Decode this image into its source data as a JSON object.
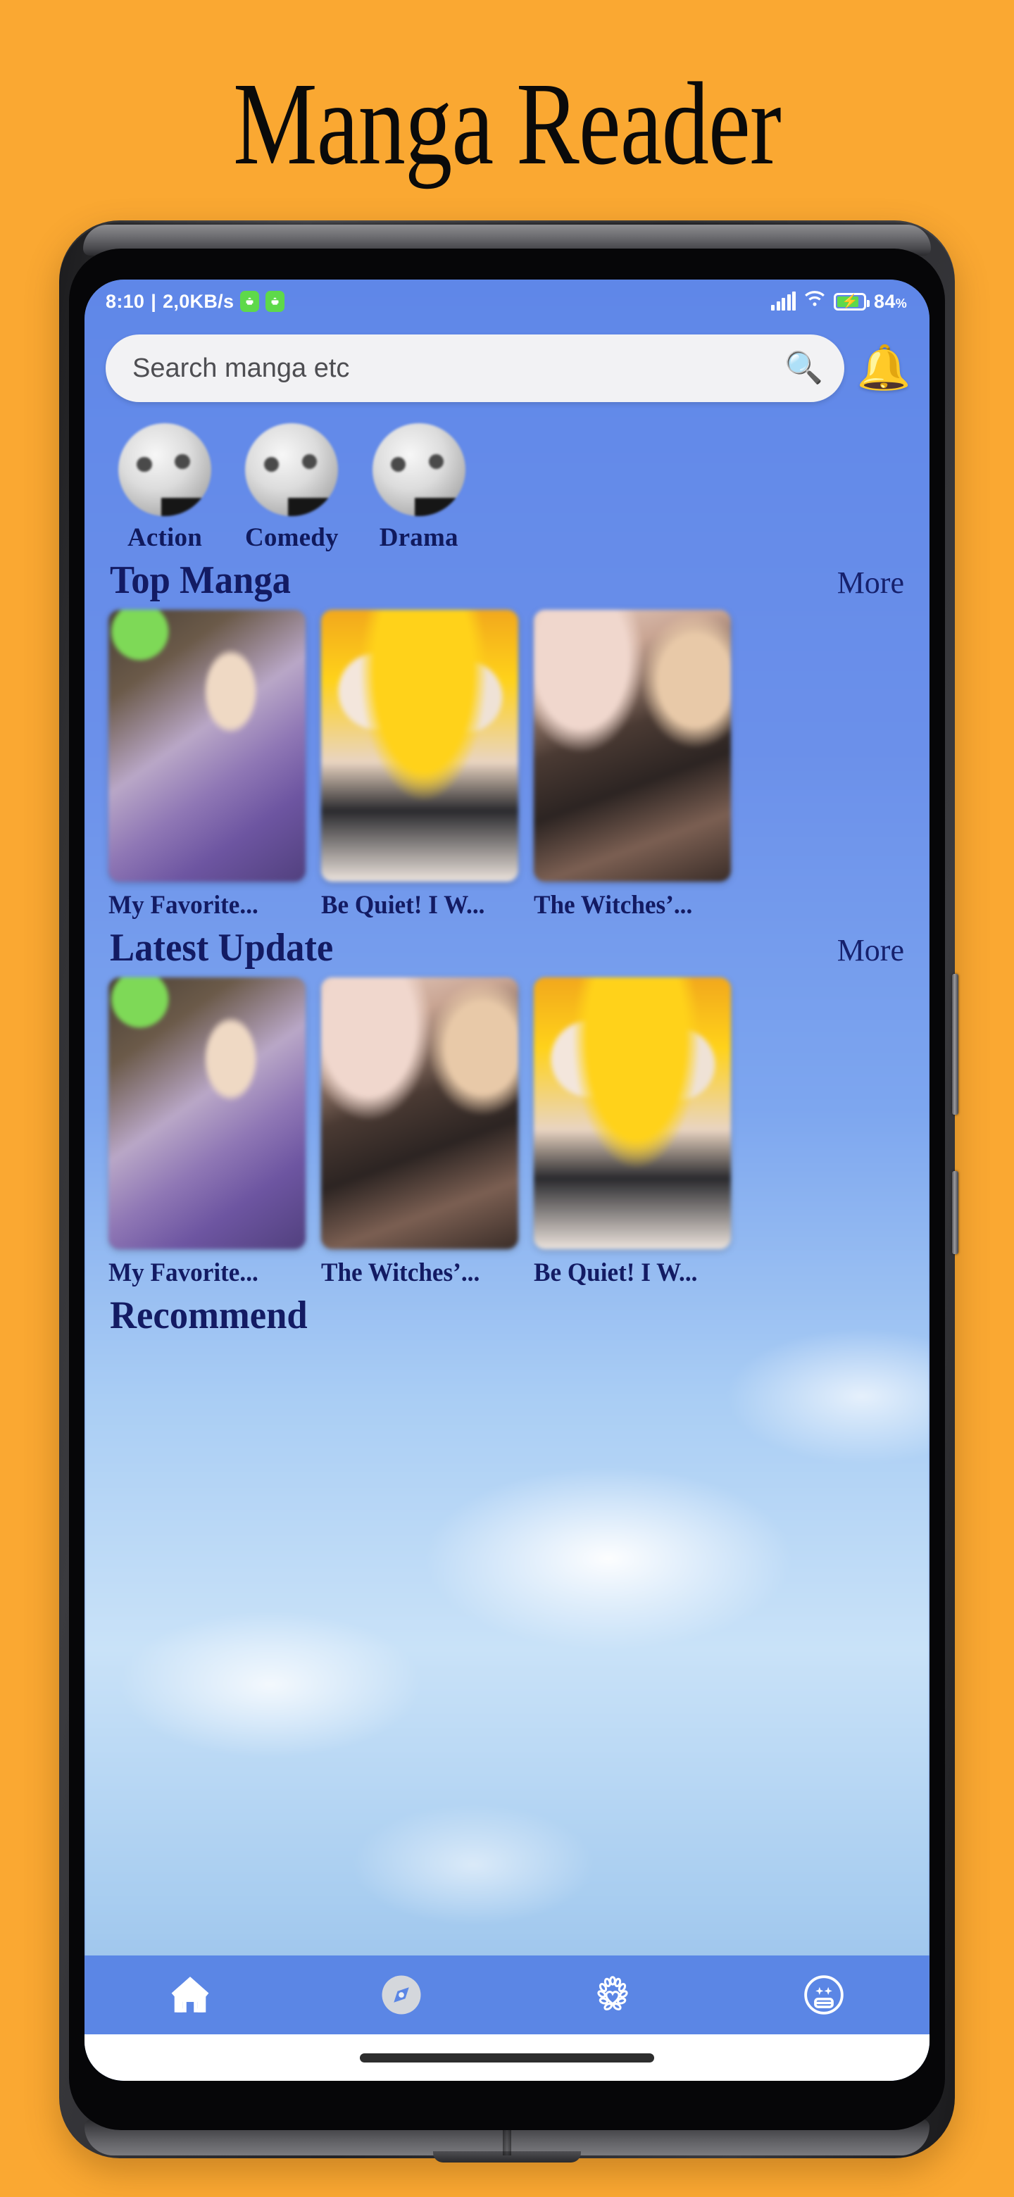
{
  "page": {
    "hero_title": "Manga Reader",
    "background_color": "#faa832",
    "app_accent_color": "#5b86e5",
    "heading_color": "#131b63"
  },
  "status_bar": {
    "time": "8:10",
    "separator": "|",
    "network_speed": "2,0KB/s",
    "app_badge_1": "android-icon",
    "app_badge_2": "android-icon",
    "signal_icon": "cellular-signal-icon",
    "wifi_icon": "wifi-icon",
    "battery_icon": "battery-charging-icon",
    "battery_percent": "84",
    "battery_percent_symbol": "%"
  },
  "search": {
    "placeholder": "Search manga etc",
    "search_icon": "magnifying-glass-icon",
    "notification_icon": "bell-icon"
  },
  "categories": [
    {
      "label": "Action",
      "avatar": "category-avatar-image"
    },
    {
      "label": "Comedy",
      "avatar": "category-avatar-image"
    },
    {
      "label": "Drama",
      "avatar": "category-avatar-image"
    }
  ],
  "sections": [
    {
      "title": "Top Manga",
      "more_label": "More",
      "items": [
        {
          "title": "My Favorite...",
          "cover": "cover-purple"
        },
        {
          "title": "Be Quiet! I W...",
          "cover": "cover-yellow"
        },
        {
          "title": "The Witches’...",
          "cover": "cover-dark"
        }
      ]
    },
    {
      "title": "Latest Update",
      "more_label": "More",
      "items": [
        {
          "title": "My Favorite...",
          "cover": "cover-purple"
        },
        {
          "title": "The Witches’...",
          "cover": "cover-dark"
        },
        {
          "title": "Be Quiet! I W...",
          "cover": "cover-yellow"
        }
      ]
    },
    {
      "title": "Recommend",
      "more_label": "",
      "items": []
    }
  ],
  "bottom_nav": [
    {
      "icon": "home-icon",
      "active": true
    },
    {
      "icon": "compass-icon",
      "active": false
    },
    {
      "icon": "favorites-icon",
      "active": false
    },
    {
      "icon": "profile-face-icon",
      "active": false
    }
  ]
}
